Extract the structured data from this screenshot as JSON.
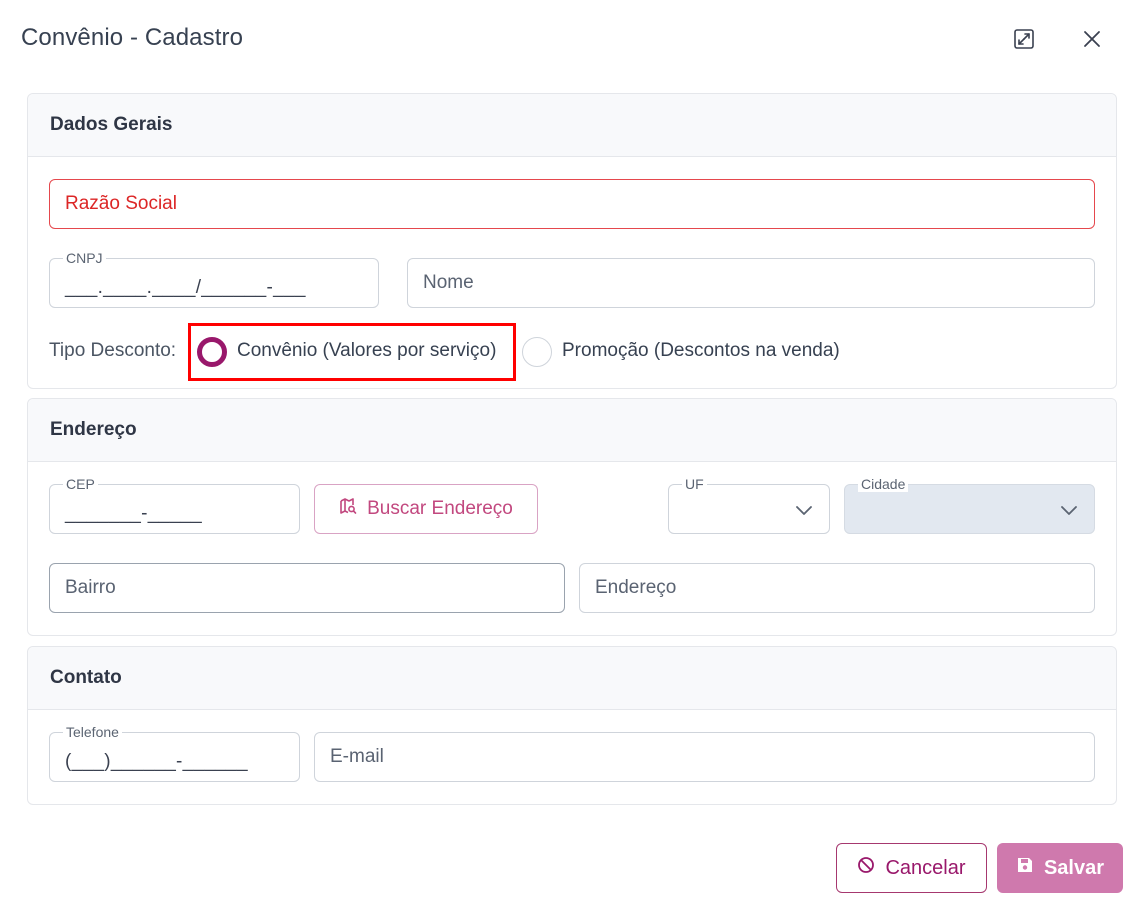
{
  "dialog": {
    "title": "Convênio - Cadastro"
  },
  "dados_gerais": {
    "title": "Dados Gerais",
    "razao_social_placeholder": "Razão Social",
    "cnpj_label": "CNPJ",
    "cnpj_mask": "___.____.____/______-___",
    "nome_placeholder": "Nome",
    "tipo_desconto_label": "Tipo Desconto:",
    "option_convenio": "Convênio (Valores por serviço)",
    "option_promocao": "Promoção (Descontos na venda)",
    "selected": "Convênio (Valores por serviço)"
  },
  "endereco": {
    "title": "Endereço",
    "cep_label": "CEP",
    "cep_mask": "_______-_____",
    "buscar_label": "Buscar Endereço",
    "uf_label": "UF",
    "cidade_label": "Cidade",
    "bairro_placeholder": "Bairro",
    "endereco_placeholder": "Endereço"
  },
  "contato": {
    "title": "Contato",
    "telefone_label": "Telefone",
    "telefone_mask": "(___)______-______",
    "email_placeholder": "E-mail"
  },
  "footer": {
    "cancel_label": "Cancelar",
    "save_label": "Salvar"
  },
  "colors": {
    "accent": "#99186b",
    "save_bg": "#cf79ad",
    "error": "#e02424",
    "highlight": "#ff0000"
  }
}
